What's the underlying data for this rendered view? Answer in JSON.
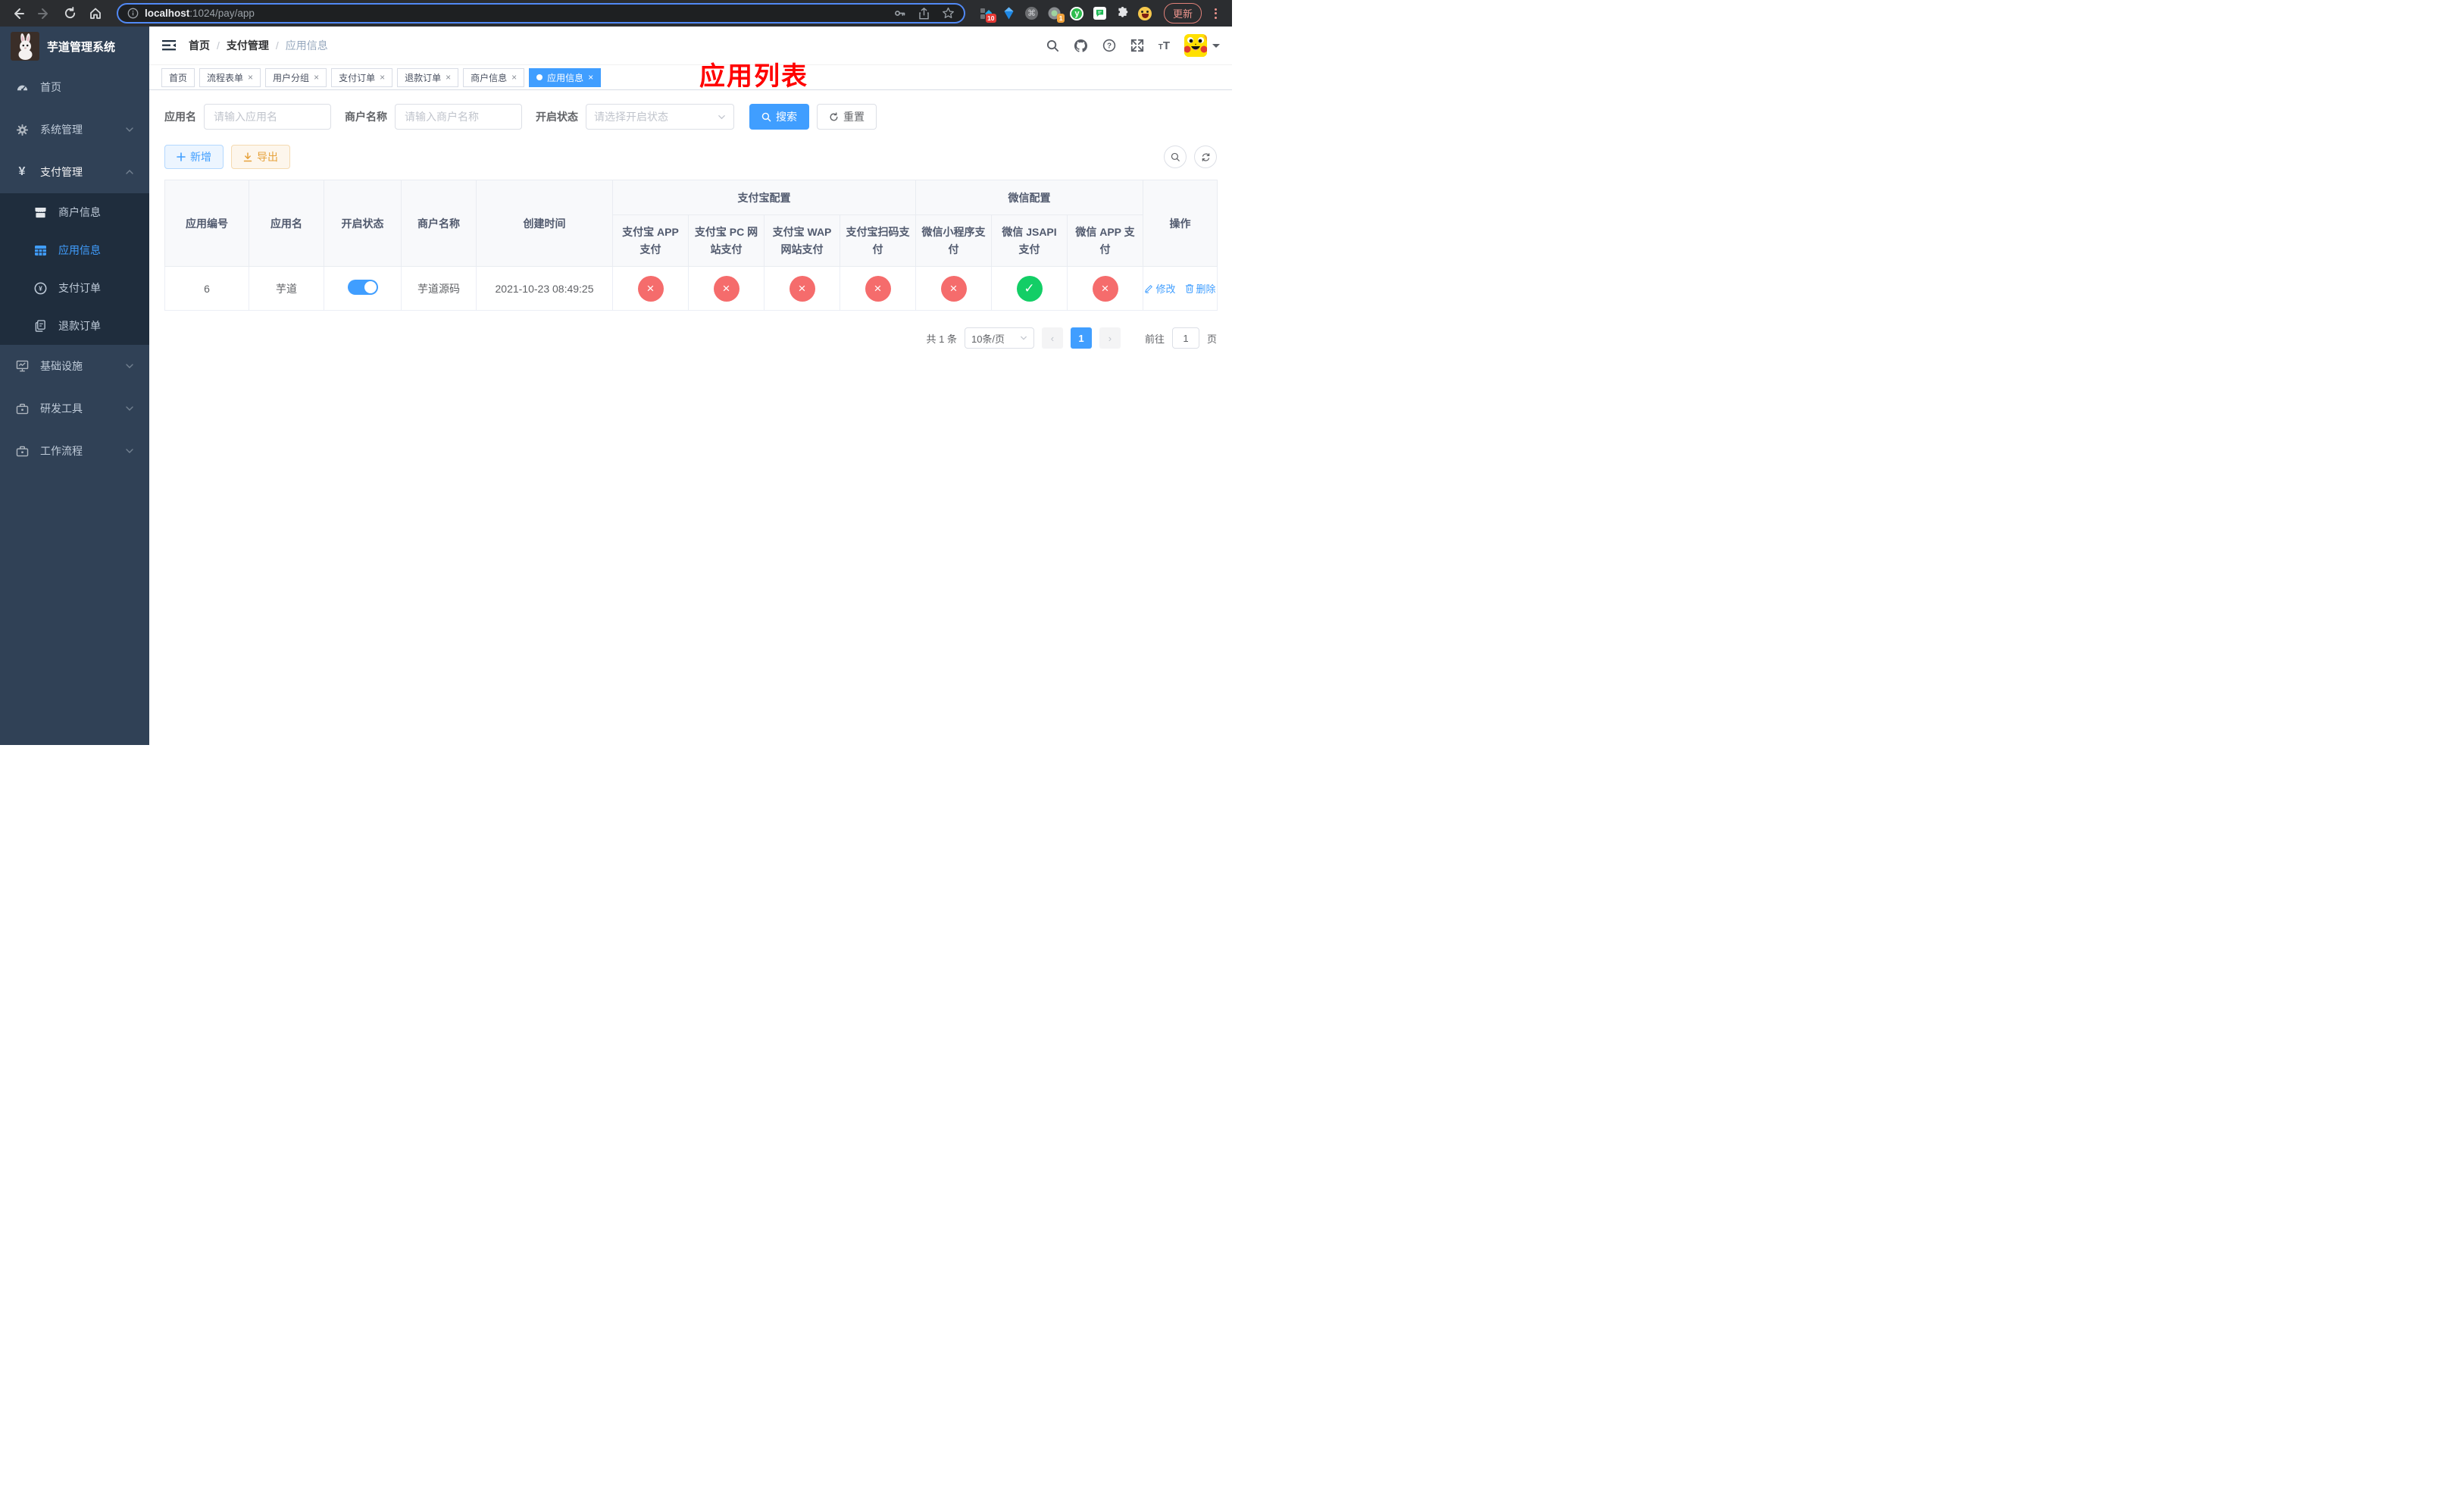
{
  "colors": {
    "accent": "#409eff",
    "success": "#13ce66",
    "danger": "#f56c6c",
    "warning": "#e6a23c",
    "annotation_red": "#ff0000",
    "sidebar_bg": "#304156",
    "submenu_bg": "#1f2d3d",
    "chrome_bg": "#2b2d30",
    "focus_ring": "#5189f5"
  },
  "browser": {
    "url_host": "localhost",
    "url_path": ":1024/pay/app",
    "update_label": "更新",
    "ext_badge_grid": "10",
    "ext_badge_circle": "1",
    "ext_y_label": "y"
  },
  "sidebar": {
    "title": "芋道管理系统",
    "home": "首页",
    "system": "系统管理",
    "payment": "支付管理",
    "merchant_info": "商户信息",
    "app_info": "应用信息",
    "pay_order": "支付订单",
    "refund_order": "退款订单",
    "infrastructure": "基础设施",
    "dev_tools": "研发工具",
    "workflow": "工作流程"
  },
  "header": {
    "breadcrumb_home": "首页",
    "breadcrumb_section": "支付管理",
    "breadcrumb_page": "应用信息",
    "annotation": "应用列表"
  },
  "tabs": {
    "items": [
      "首页",
      "流程表单",
      "用户分组",
      "支付订单",
      "退款订单",
      "商户信息",
      "应用信息"
    ]
  },
  "filters": {
    "app_name_label": "应用名",
    "app_name_placeholder": "请输入应用名",
    "merchant_label": "商户名称",
    "merchant_placeholder": "请输入商户名称",
    "status_label": "开启状态",
    "status_placeholder": "请选择开启状态",
    "search_label": "搜索",
    "reset_label": "重置"
  },
  "toolbar": {
    "add_label": "新增",
    "export_label": "导出"
  },
  "table": {
    "headers": {
      "app_id": "应用编号",
      "app_name": "应用名",
      "open_status": "开启状态",
      "merchant_name": "商户名称",
      "create_time": "创建时间",
      "alipay_group": "支付宝配置",
      "wechat_group": "微信配置",
      "action": "操作",
      "sub": [
        "支付宝 APP 支付",
        "支付宝 PC 网站支付",
        "支付宝 WAP 网站支付",
        "支付宝扫码支付",
        "微信小程序支付",
        "微信 JSAPI 支付",
        "微信 APP 支付"
      ]
    },
    "row": {
      "id": "6",
      "name": "芋道",
      "enabled": true,
      "merchant": "芋道源码",
      "created": "2021-10-23 08:49:25",
      "statuses": [
        false,
        false,
        false,
        false,
        false,
        true,
        false
      ],
      "edit_label": "修改",
      "delete_label": "删除"
    }
  },
  "pagination": {
    "total": "共 1 条",
    "page_size": "10条/页",
    "current_page": "1",
    "goto_label": "前往",
    "goto_value": "1",
    "unit_label": "页"
  }
}
